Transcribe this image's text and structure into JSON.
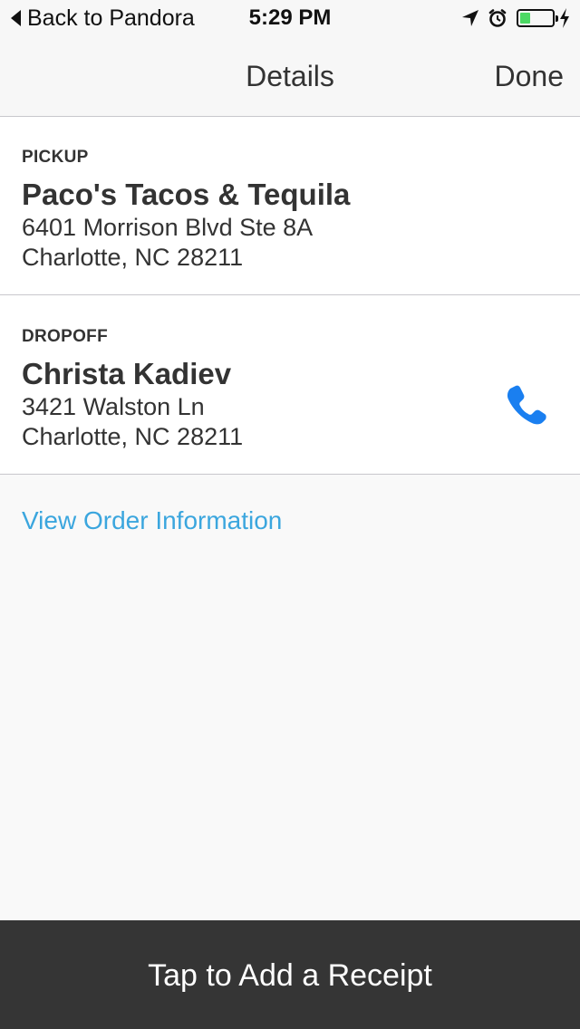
{
  "status_bar": {
    "back_label": "Back to Pandora",
    "time": "5:29 PM",
    "icons": [
      "location-arrow-icon",
      "alarm-clock-icon",
      "battery-icon",
      "charging-bolt-icon"
    ],
    "battery_level": 0.33,
    "battery_color": "#4cd964"
  },
  "nav": {
    "title": "Details",
    "done_label": "Done"
  },
  "pickup": {
    "label": "PICKUP",
    "name": "Paco's Tacos & Tequila",
    "address_line1": "6401 Morrison Blvd Ste 8A",
    "address_line2": "Charlotte, NC 28211"
  },
  "dropoff": {
    "label": "DROPOFF",
    "name": "Christa Kadiev",
    "address_line1": "3421 Walston Ln",
    "address_line2": "Charlotte, NC 28211",
    "phone_icon": "phone-icon",
    "phone_color": "#1a7ff0"
  },
  "links": {
    "view_order": "View Order Information",
    "link_color": "#3ba6de"
  },
  "bottom_bar": {
    "label": "Tap to Add a Receipt",
    "background": "#353535"
  }
}
